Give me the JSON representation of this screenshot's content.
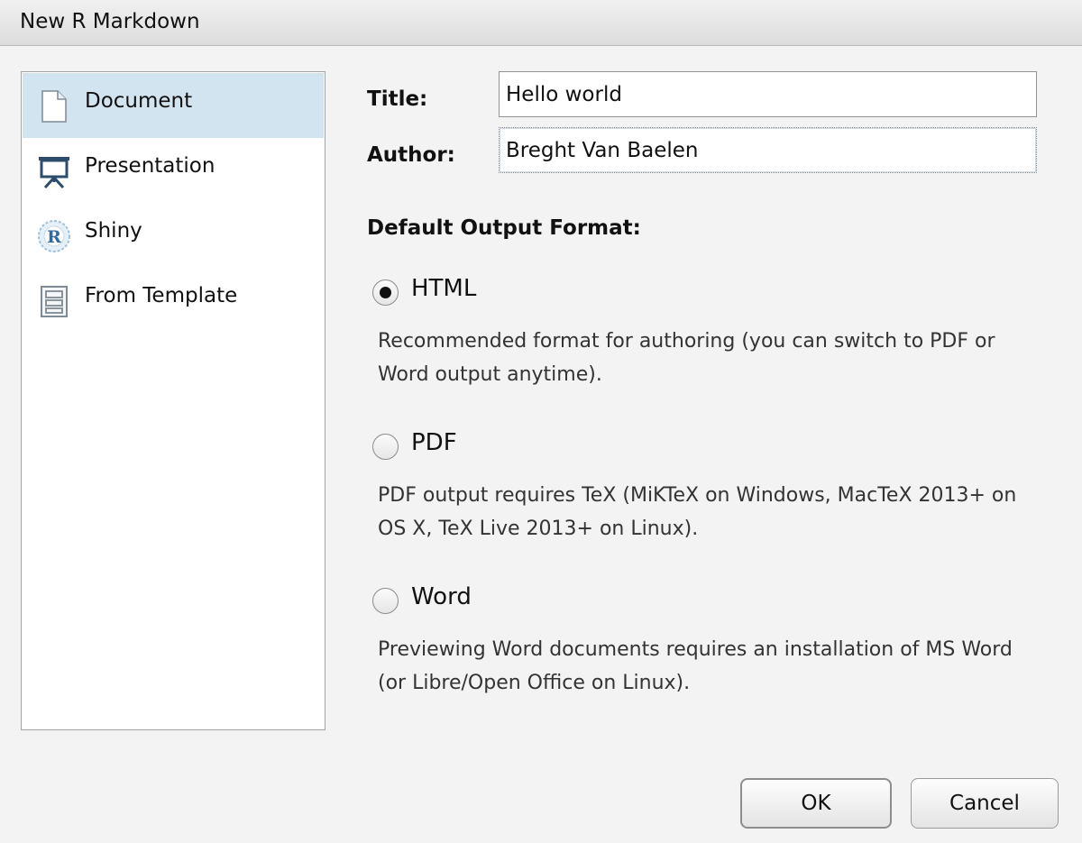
{
  "window": {
    "title": "New R Markdown"
  },
  "sidebar": {
    "items": [
      {
        "label": "Document",
        "icon": "document-icon",
        "selected": true
      },
      {
        "label": "Presentation",
        "icon": "presentation-icon",
        "selected": false
      },
      {
        "label": "Shiny",
        "icon": "shiny-icon",
        "selected": false
      },
      {
        "label": "From Template",
        "icon": "template-icon",
        "selected": false
      }
    ]
  },
  "form": {
    "title_label": "Title:",
    "title_value": "Hello world",
    "author_label": "Author:",
    "author_value": "Breght Van Baelen"
  },
  "output": {
    "heading": "Default Output Format:",
    "options": [
      {
        "label": "HTML",
        "checked": true,
        "description": "Recommended format for authoring (you can switch to PDF or Word output anytime)."
      },
      {
        "label": "PDF",
        "checked": false,
        "description": "PDF output requires TeX (MiKTeX on Windows, MacTeX 2013+ on OS X, TeX Live 2013+ on Linux)."
      },
      {
        "label": "Word",
        "checked": false,
        "description": "Previewing Word documents requires an installation of MS Word (or Libre/Open Office on Linux)."
      }
    ]
  },
  "buttons": {
    "ok": "OK",
    "cancel": "Cancel"
  },
  "colors": {
    "selection": "#d3e4f1",
    "background": "#f2f3f2",
    "icon_blue": "#2d4b6b"
  }
}
